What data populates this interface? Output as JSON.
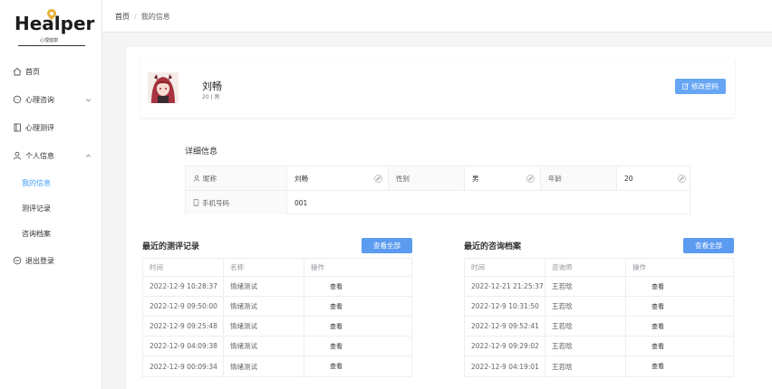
{
  "logo": {
    "text": "Healper",
    "subtitle": "心理健康"
  },
  "sidebar": {
    "items": [
      {
        "label": "首页",
        "icon": "home-icon"
      },
      {
        "label": "心理咨询",
        "icon": "chat-icon"
      },
      {
        "label": "心理测评",
        "icon": "book-icon"
      },
      {
        "label": "个人信息",
        "icon": "user-icon"
      }
    ],
    "subitems": [
      {
        "label": "我的信息",
        "active": true
      },
      {
        "label": "测评记录",
        "active": false
      },
      {
        "label": "咨询档案",
        "active": false
      }
    ],
    "logout": "退出登录"
  },
  "breadcrumb": {
    "home": "首页",
    "sep": "/",
    "current": "我的信息"
  },
  "profile": {
    "name": "刘畅",
    "sub": "20 | 男",
    "change_password": "修改密码"
  },
  "details": {
    "title": "详细信息",
    "nickname_label": "昵称",
    "nickname": "刘畅",
    "gender_label": "性别",
    "gender": "男",
    "age_label": "年龄",
    "age": "20",
    "phone_label": "手机号码",
    "phone": "001"
  },
  "tests": {
    "title": "最近的测评记录",
    "view_all": "查看全部",
    "headers": [
      "时间",
      "名称",
      "操作"
    ],
    "rows": [
      {
        "time": "2022-12-9 10:28:37",
        "name": "情绪测试",
        "action": "查看"
      },
      {
        "time": "2022-12-9 09:50:00",
        "name": "情绪测试",
        "action": "查看"
      },
      {
        "time": "2022-12-9 09:25:48",
        "name": "情绪测试",
        "action": "查看"
      },
      {
        "time": "2022-12-9 04:09:38",
        "name": "情绪测试",
        "action": "查看"
      },
      {
        "time": "2022-12-9 00:09:34",
        "name": "情绪测试",
        "action": "查看"
      }
    ]
  },
  "consults": {
    "title": "最近的咨询档案",
    "view_all": "查看全部",
    "headers": [
      "时间",
      "咨询师",
      "操作"
    ],
    "rows": [
      {
        "time": "2022-12-21 21:25:37",
        "name": "王若晗",
        "action": "查看"
      },
      {
        "time": "2022-12-9 10:31:50",
        "name": "王若晗",
        "action": "查看"
      },
      {
        "time": "2022-12-9 09:52:41",
        "name": "王若晗",
        "action": "查看"
      },
      {
        "time": "2022-12-9 09:29:02",
        "name": "王若晗",
        "action": "查看"
      },
      {
        "time": "2022-12-9 04:19:01",
        "name": "王若晗",
        "action": "查看"
      }
    ]
  },
  "colors": {
    "accent": "#409eff",
    "button": "#5b9bf0"
  }
}
